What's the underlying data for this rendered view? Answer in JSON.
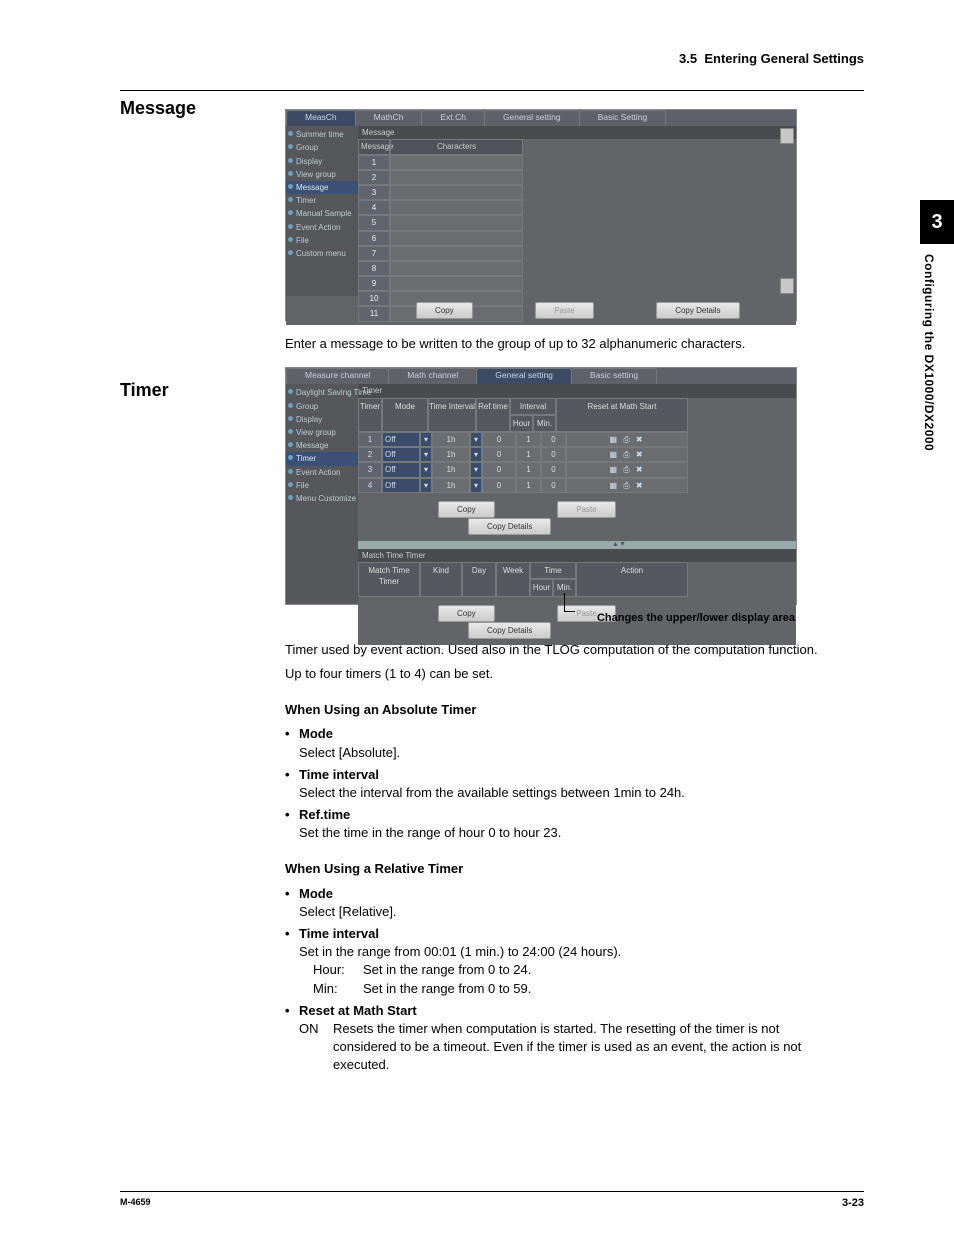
{
  "header": {
    "section": "3.5",
    "title": "Entering General Settings"
  },
  "sideTab": {
    "chapter": "3",
    "text": "Configuring the DX1000/DX2000"
  },
  "message": {
    "heading": "Message",
    "tabs": [
      "MeasCh",
      "MathCh",
      "Ext.Ch",
      "General setting",
      "Basic Setting"
    ],
    "selectedTab": 0,
    "sidebar": [
      "Summer time",
      "Group",
      "Display",
      "View group",
      "Message",
      "Timer",
      "Manual Sample",
      "Event Action",
      "File",
      "Custom menu"
    ],
    "selectedSide": 4,
    "panelLabel": "Message",
    "columns": [
      "Message",
      "Characters"
    ],
    "rows": [
      "1",
      "2",
      "3",
      "4",
      "5",
      "6",
      "7",
      "8",
      "9",
      "10",
      "11"
    ],
    "buttons": {
      "copy": "Copy",
      "paste": "Paste",
      "copyDetails": "Copy Details"
    },
    "desc": "Enter a message to be written to the group of up to 32 alphanumeric characters."
  },
  "timer": {
    "heading": "Timer",
    "tabs": [
      "Measure channel",
      "Math channel",
      "General setting",
      "Basic setting"
    ],
    "selectedTab": 2,
    "sidebar": [
      "Daylight Saving Time",
      "Group",
      "Display",
      "View group",
      "Message",
      "Timer",
      "Event Action",
      "File",
      "Menu Customize"
    ],
    "selectedSide": 5,
    "topPanelLabel": "Timer",
    "topHead": {
      "timer": "Timer",
      "mode": "Mode",
      "timeInterval": "Time Interval",
      "refTime": "Ref.time",
      "interval": "Interval",
      "hour": "Hour",
      "min": "Min.",
      "reset": "Reset at Math Start"
    },
    "topRows": [
      {
        "n": "1",
        "mode": "Off",
        "ti": "1h",
        "ref": "0",
        "h": "1",
        "m": "0"
      },
      {
        "n": "2",
        "mode": "Off",
        "ti": "1h",
        "ref": "0",
        "h": "1",
        "m": "0"
      },
      {
        "n": "3",
        "mode": "Off",
        "ti": "1h",
        "ref": "0",
        "h": "1",
        "m": "0"
      },
      {
        "n": "4",
        "mode": "Off",
        "ti": "1h",
        "ref": "0",
        "h": "1",
        "m": "0"
      }
    ],
    "bottomPanelLabel": "Match Time Timer",
    "bottomHead": {
      "mtt": "Match Time Timer",
      "kind": "Kind",
      "day": "Day",
      "week": "Week",
      "time": "Time",
      "hour": "Hour",
      "min": "Min.",
      "action": "Action"
    },
    "buttons": {
      "copy": "Copy",
      "paste": "Paste",
      "copyDetails": "Copy Details"
    },
    "caption": "Changes the upper/lower display area",
    "desc1": "Timer used by event action.  Used also in the TLOG computation of the computation function.",
    "desc2": "Up to four timers (1 to 4) can be set.",
    "abs": {
      "title": "When Using an Absolute Timer",
      "mode": {
        "k": "Mode",
        "v": "Select [Absolute]."
      },
      "ti": {
        "k": "Time interval",
        "v": "Select the interval from the available settings between 1min to 24h."
      },
      "rt": {
        "k": "Ref.time",
        "v": "Set the time in the range of hour 0 to hour 23."
      }
    },
    "rel": {
      "title": "When Using a Relative Timer",
      "mode": {
        "k": "Mode",
        "v": "Select [Relative]."
      },
      "ti": {
        "k": "Time interval",
        "v": "Set in the range from 00:01 (1 min.) to 24:00 (24 hours).",
        "hour": "Set in the range from 0 to 24.",
        "min": "Set in the range from 0 to 59.",
        "hourLbl": "Hour:",
        "minLbl": "Min:"
      },
      "reset": {
        "k": "Reset at Math Start",
        "on": "ON",
        "v": "Resets the timer when computation is started.  The resetting of the timer is not considered to be a timeout.  Even if the timer is used as an event, the action is not executed."
      }
    }
  },
  "footer": {
    "left": "M-4659",
    "right": "3-23"
  }
}
